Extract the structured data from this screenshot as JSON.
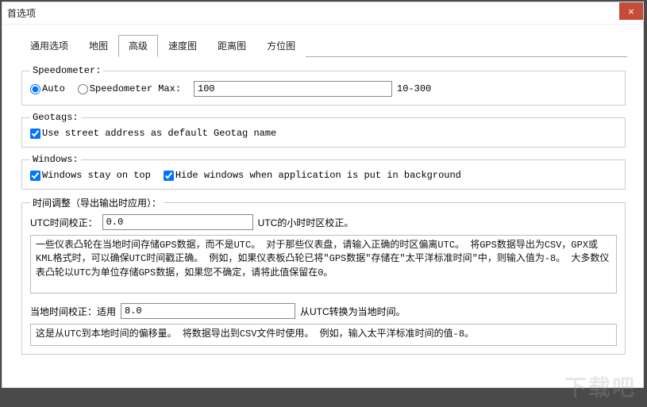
{
  "window": {
    "title": "首选项",
    "close": "×"
  },
  "tabs": [
    {
      "label": "通用选项"
    },
    {
      "label": "地图"
    },
    {
      "label": "高级"
    },
    {
      "label": "速度图"
    },
    {
      "label": "距离图"
    },
    {
      "label": "方位图"
    }
  ],
  "speedometer": {
    "legend": "Speedometer:",
    "auto_label": "Auto",
    "max_label": "Speedometer Max:",
    "max_value": "100",
    "range_hint": "10-300"
  },
  "geotags": {
    "legend": "Geotags:",
    "use_street_label": "Use street address as default Geotag name"
  },
  "windows": {
    "legend": "Windows:",
    "stay_on_top_label": "Windows stay on top",
    "hide_bg_label": "Hide windows when application is put in background"
  },
  "time": {
    "legend": "时间调整（导出输出时应用）：",
    "utc_label": "UTC时间校正：",
    "utc_value": "0.0",
    "utc_hint": "UTC的小时时区校正。",
    "utc_help": "一些仪表凸轮在当地时间存储GPS数据，而不是UTC。 对于那些仪表盘，请输入正确的时区偏离UTC。 将GPS数据导出为CSV，GPX或KML格式时，可以确保UTC时间戳正确。 例如，如果仪表板凸轮已将\"GPS数据\"存储在\"太平洋标准时间\"中，则输入值为-8。 大多数仪表凸轮以UTC为单位存储GPS数据，如果您不确定，请将此值保留在0。",
    "local_label": "当地时间校正：适用",
    "local_value": "8.0",
    "local_hint": "从UTC转换为当地时间。",
    "local_help": "这是从UTC到本地时间的偏移量。 将数据导出到CSV文件时使用。 例如，输入太平洋标准时间的值-8。"
  },
  "watermark": "下载吧"
}
